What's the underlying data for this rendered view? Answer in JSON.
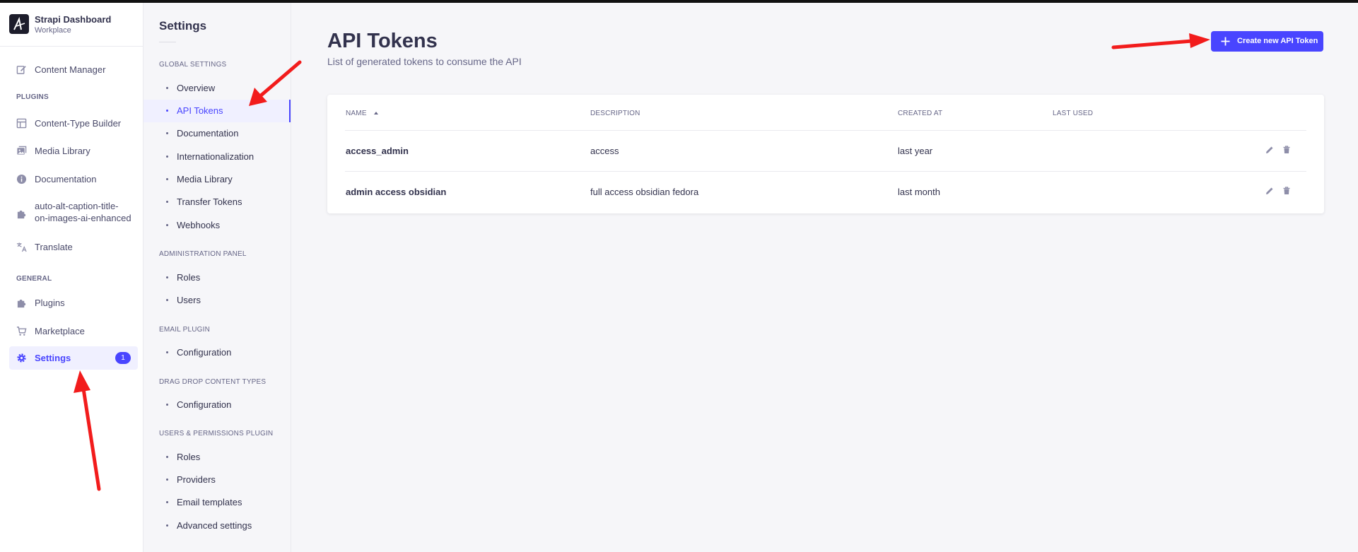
{
  "app": {
    "brand_name": "Strapi Dashboard",
    "brand_sub": "Workplace"
  },
  "mainnav": {
    "content_manager": "Content Manager",
    "plugins_section": "PLUGINS",
    "content_type_builder": "Content-Type Builder",
    "media_library": "Media Library",
    "documentation": "Documentation",
    "auto_alt_line1": "auto-alt-caption-title-",
    "auto_alt_line2": "on-images-ai-enhanced",
    "translate": "Translate",
    "general_section": "GENERAL",
    "plugins": "Plugins",
    "marketplace": "Marketplace",
    "settings": "Settings",
    "settings_badge": "1"
  },
  "subnav": {
    "title": "Settings",
    "global_section": "GLOBAL SETTINGS",
    "global_items": [
      "Overview",
      "API Tokens",
      "Documentation",
      "Internationalization",
      "Media Library",
      "Transfer Tokens",
      "Webhooks"
    ],
    "admin_section": "ADMINISTRATION PANEL",
    "admin_items": [
      "Roles",
      "Users"
    ],
    "email_section": "EMAIL PLUGIN",
    "email_items": [
      "Configuration"
    ],
    "dragdrop_section": "DRAG DROP CONTENT TYPES",
    "dragdrop_items": [
      "Configuration"
    ],
    "users_section": "USERS & PERMISSIONS PLUGIN",
    "users_items": [
      "Roles",
      "Providers",
      "Email templates",
      "Advanced settings"
    ]
  },
  "page": {
    "title": "API Tokens",
    "subtitle": "List of generated tokens to consume the API",
    "create_button": "Create new API Token"
  },
  "table": {
    "headers": {
      "name": "NAME",
      "description": "DESCRIPTION",
      "created_at": "CREATED AT",
      "last_used": "LAST USED"
    },
    "rows": [
      {
        "name": "access_admin",
        "description": "access",
        "created_at": "last year",
        "last_used": ""
      },
      {
        "name": "admin access obsidian",
        "description": "full access obsidian fedora",
        "created_at": "last month",
        "last_used": ""
      }
    ]
  },
  "colors": {
    "primary": "#4945ff",
    "annotation": "#f21c1c"
  }
}
